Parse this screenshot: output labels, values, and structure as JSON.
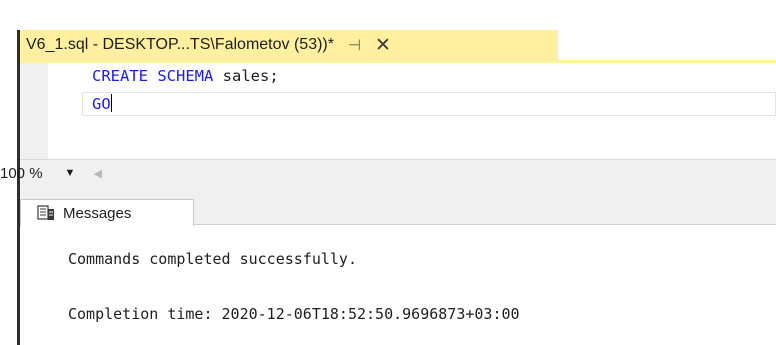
{
  "document_tab": {
    "title": "V6_1.sql - DESKTOP...TS\\Falometov (53))*",
    "pin_glyph": "⊣",
    "close_glyph": "✕",
    "accent_color": "#ffef9f"
  },
  "editor": {
    "lines": [
      {
        "keyword": "CREATE SCHEMA",
        "rest": " sales;"
      },
      {
        "keyword": "GO",
        "rest": ""
      }
    ],
    "keyword_color": "#1a1aff"
  },
  "statusbar": {
    "zoom": "100 %",
    "zoom_dropdown_glyph": "▼",
    "scroll_left_glyph": "◀"
  },
  "results": {
    "tab_label": "Messages",
    "tab_icon": "messages-icon",
    "messages": [
      "Commands completed successfully.",
      "Completion time: 2020-12-06T18:52:50.9696873+03:00"
    ]
  }
}
